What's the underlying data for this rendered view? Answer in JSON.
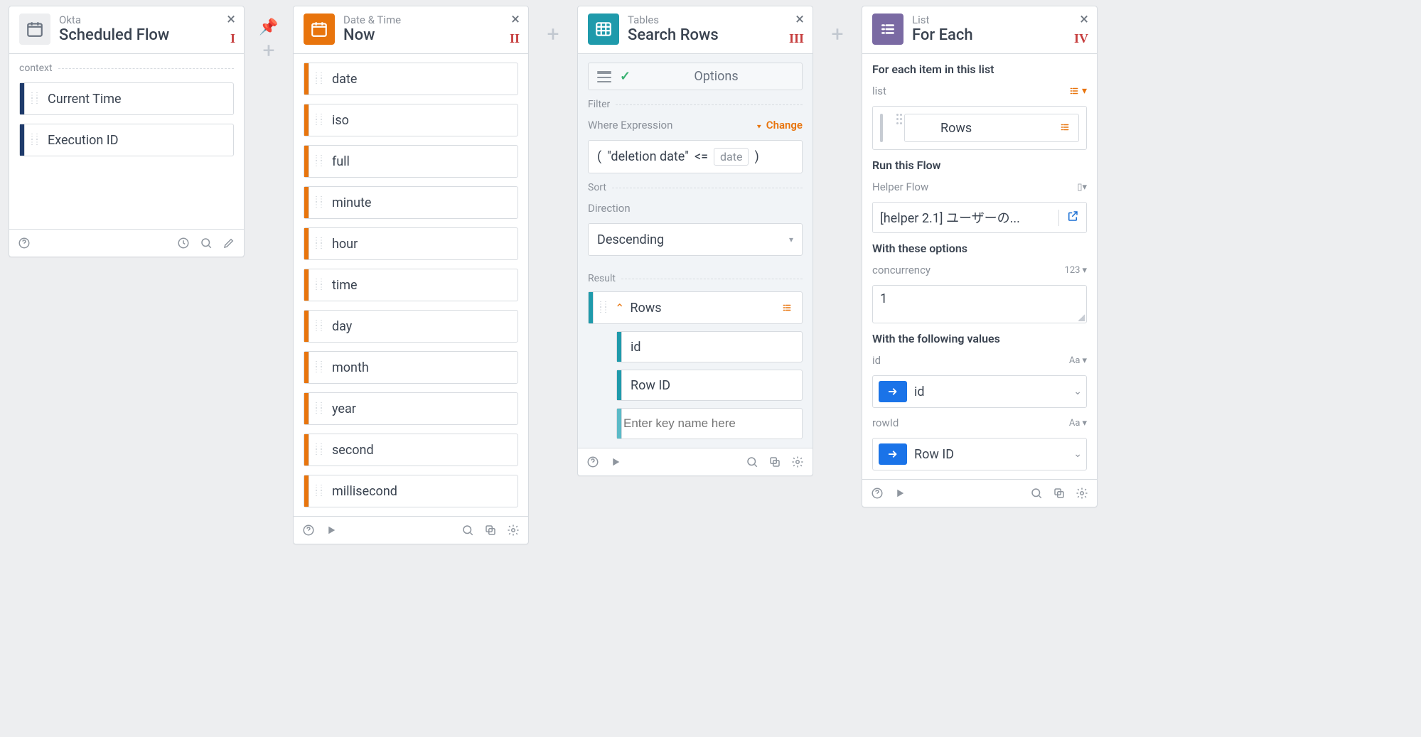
{
  "cards": {
    "okta": {
      "category": "Okta",
      "title": "Scheduled Flow",
      "step": "I",
      "context_label": "context",
      "outputs": [
        "Current Time",
        "Execution ID"
      ]
    },
    "datetime": {
      "category": "Date & Time",
      "title": "Now",
      "step": "II",
      "outputs": [
        "date",
        "iso",
        "full",
        "minute",
        "hour",
        "time",
        "day",
        "month",
        "year",
        "second",
        "millisecond"
      ]
    },
    "tables": {
      "category": "Tables",
      "title": "Search Rows",
      "step": "III",
      "options_label": "Options",
      "filter_label": "Filter",
      "where_label": "Where Expression",
      "change_label": "Change",
      "expr_parts": {
        "open": "(",
        "field": "\"deletion date\"",
        "op": "<=",
        "var": "date",
        "close": ")"
      },
      "sort_label": "Sort",
      "direction_label": "Direction",
      "direction_value": "Descending",
      "result_label": "Result",
      "rows_label": "Rows",
      "row_children": [
        "id",
        "Row ID"
      ],
      "row_placeholder": "Enter key name here"
    },
    "foreach": {
      "category": "List",
      "title": "For Each",
      "step": "IV",
      "section_foreach": "For each item in this list",
      "list_label": "list",
      "list_value": "Rows",
      "section_run": "Run this Flow",
      "helper_label": "Helper Flow",
      "helper_value": "[helper 2.1] ユーザーの...",
      "section_options": "With these options",
      "concurrency_label": "concurrency",
      "concurrency_value": "1",
      "concurrency_type": "123",
      "section_values": "With the following values",
      "val1_label": "id",
      "val1_chip": "id",
      "val1_type": "Aa",
      "val2_label": "rowId",
      "val2_chip": "Row ID",
      "val2_type": "Aa",
      "helper_type": "⌴"
    }
  }
}
